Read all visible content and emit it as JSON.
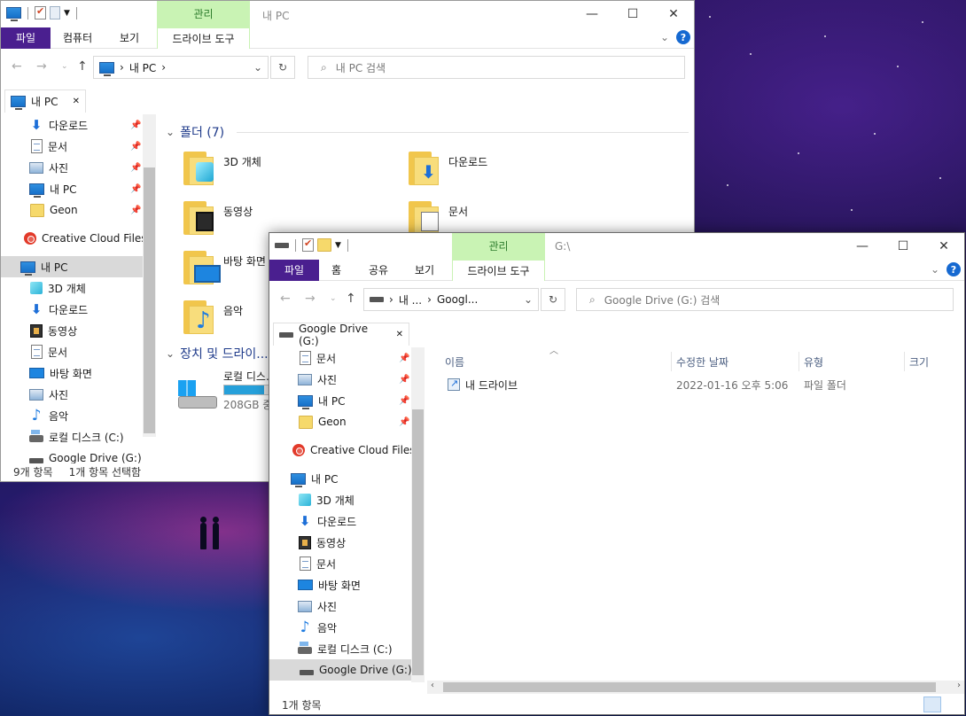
{
  "colors": {
    "file_tab": "#4a1f8f",
    "context_tab": "#c9f3b4",
    "help": "#1669d1"
  },
  "window_back": {
    "context_group": "관리",
    "title": "내 PC",
    "ribbon_tabs": [
      "파일",
      "컴퓨터",
      "보기",
      "드라이브 도구"
    ],
    "address": {
      "crumbs": [
        "내 PC"
      ]
    },
    "search_placeholder": "내 PC 검색",
    "quick_access_tab": "내 PC",
    "sidebar": [
      {
        "label": "다운로드",
        "icon": "download-icon",
        "pinned": true
      },
      {
        "label": "문서",
        "icon": "document-icon",
        "pinned": true
      },
      {
        "label": "사진",
        "icon": "pictures-icon",
        "pinned": true
      },
      {
        "label": "내 PC",
        "icon": "pc-icon",
        "pinned": true
      },
      {
        "label": "Geon",
        "icon": "folder-icon",
        "pinned": true
      },
      {
        "label": "Creative Cloud Files",
        "icon": "creative-cloud-icon"
      },
      {
        "label": "내 PC",
        "icon": "pc-icon",
        "selected": true
      },
      {
        "label": "3D 개체",
        "icon": "3d-objects-icon"
      },
      {
        "label": "다운로드",
        "icon": "download-icon"
      },
      {
        "label": "동영상",
        "icon": "video-icon"
      },
      {
        "label": "문서",
        "icon": "document-icon"
      },
      {
        "label": "바탕 화면",
        "icon": "desktop-icon"
      },
      {
        "label": "사진",
        "icon": "pictures-icon"
      },
      {
        "label": "음악",
        "icon": "music-icon"
      },
      {
        "label": "로컬 디스크 (C:)",
        "icon": "local-disk-icon"
      },
      {
        "label": "Google Drive (G:)",
        "icon": "drive-icon"
      }
    ],
    "folders_header": "폴더 (7)",
    "folders": [
      {
        "label": "3D 개체",
        "icon": "3d-objects-icon"
      },
      {
        "label": "다운로드",
        "icon": "download-icon"
      },
      {
        "label": "동영상",
        "icon": "video-icon"
      },
      {
        "label": "문서",
        "icon": "document-icon"
      },
      {
        "label": "바탕 화면",
        "icon": "desktop-icon"
      },
      {
        "label": "음악",
        "icon": "music-icon"
      }
    ],
    "devices_header": "장치 및 드라이...",
    "device": {
      "label": "로컬 디스...",
      "size": "208GB 중...",
      "fill_fraction": 0.9
    },
    "status": {
      "count": "9개 항목",
      "selected": "1개 항목 선택함"
    }
  },
  "window_front": {
    "context_group": "관리",
    "title": "G:\\",
    "ribbon_tabs": [
      "파일",
      "홈",
      "공유",
      "보기",
      "드라이브 도구"
    ],
    "address": {
      "crumbs": [
        "내 ...",
        "Googl..."
      ]
    },
    "search_placeholder": "Google Drive (G:) 검색",
    "quick_access_tab": "Google Drive (G:)",
    "sidebar": [
      {
        "label": "문서",
        "icon": "document-icon",
        "pinned": true
      },
      {
        "label": "사진",
        "icon": "pictures-icon",
        "pinned": true
      },
      {
        "label": "내 PC",
        "icon": "pc-icon",
        "pinned": true
      },
      {
        "label": "Geon",
        "icon": "folder-icon",
        "pinned": true
      },
      {
        "label": "Creative Cloud Files",
        "icon": "creative-cloud-icon"
      },
      {
        "label": "내 PC",
        "icon": "pc-icon"
      },
      {
        "label": "3D 개체",
        "icon": "3d-objects-icon"
      },
      {
        "label": "다운로드",
        "icon": "download-icon"
      },
      {
        "label": "동영상",
        "icon": "video-icon"
      },
      {
        "label": "문서",
        "icon": "document-icon"
      },
      {
        "label": "바탕 화면",
        "icon": "desktop-icon"
      },
      {
        "label": "사진",
        "icon": "pictures-icon"
      },
      {
        "label": "음악",
        "icon": "music-icon"
      },
      {
        "label": "로컬 디스크 (C:)",
        "icon": "local-disk-icon"
      },
      {
        "label": "Google Drive (G:)",
        "icon": "drive-icon",
        "selected": true
      }
    ],
    "columns": [
      "이름",
      "수정한 날짜",
      "유형",
      "크기"
    ],
    "rows": [
      {
        "name": "내 드라이브",
        "modified": "2022-01-16 오후 5:06",
        "type": "파일 폴더",
        "size": ""
      }
    ],
    "status": {
      "count": "1개 항목"
    }
  }
}
